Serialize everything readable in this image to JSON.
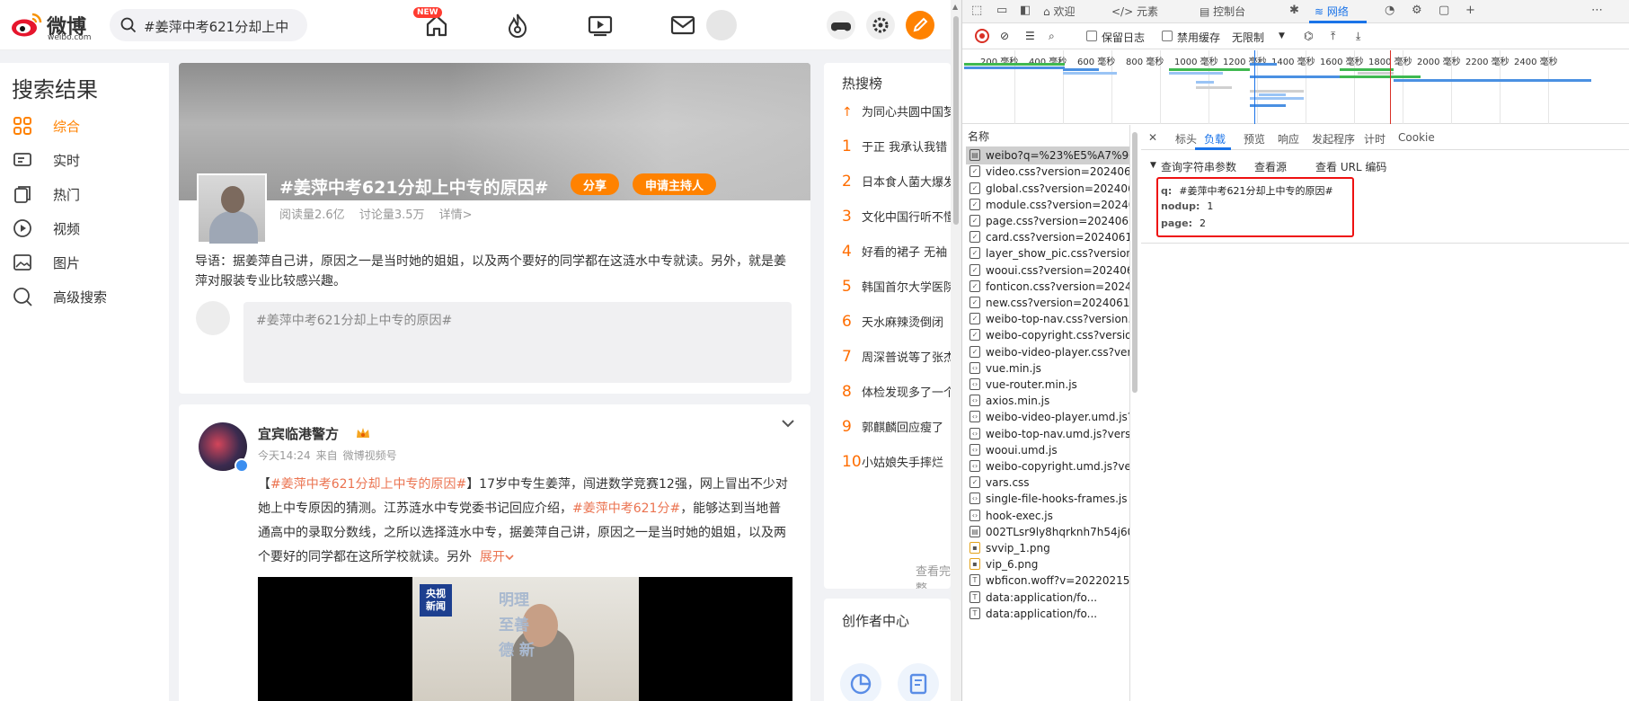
{
  "weibo": {
    "brand": "微博",
    "brand_sub": "weibo.com",
    "search": {
      "value": "#姜萍中考621分却上中"
    },
    "nav": {
      "new_badge": "NEW"
    },
    "leftnav": {
      "title": "搜索结果",
      "items": [
        {
          "label": "综合",
          "icon": "grid-icon",
          "active": true
        },
        {
          "label": "实时",
          "icon": "chat-icon"
        },
        {
          "label": "热门",
          "icon": "hot-icon"
        },
        {
          "label": "视频",
          "icon": "play-icon"
        },
        {
          "label": "图片",
          "icon": "image-icon"
        },
        {
          "label": "高级搜索",
          "icon": "search-icon"
        }
      ]
    },
    "topic_card": {
      "title": "#姜萍中考621分却上中专的原因#",
      "share_label": "分享",
      "host_label": "申请主持人",
      "reads": "阅读量2.6亿",
      "discussions": "讨论量3.5万",
      "details": "详情>",
      "guide": "导语：据姜萍自己讲，原因之一是当时她的姐姐，以及两个要好的同学都在这涟水中专就读。另外，就是姜萍对服装专业比较感兴趣。",
      "comment_placeholder": "#姜萍中考621分却上中专的原因#"
    },
    "post": {
      "author": "宜宾临港警方",
      "time": "今天14:24",
      "source_prefix": "来自",
      "source": "微博视频号",
      "text_open": "【",
      "link1": "#姜萍中考621分却上中专的原因#",
      "text_1": "】17岁中专生姜萍，闯进数学竞赛12强，网上冒出不少对她上中专原因的猜测。江苏涟水中专党委书记回应介绍，",
      "link2": "#姜萍中考621分#",
      "text_2": "，能够达到当地普通高中的录取分数线，之所以选择涟水中专，据姜萍自己讲，原因之一是当时她的姐姐，以及两个要好的同学都在这所学校就读。另外",
      "expand": "展开",
      "video_logo_1": "央视",
      "video_logo_2": "新闻",
      "video_signs": "明理 至善 德 新"
    },
    "hot": {
      "title": "热搜榜",
      "items": [
        {
          "rank": "",
          "text": "为同心共圆中国梦"
        },
        {
          "rank": "1",
          "text": "于正 我承认我错"
        },
        {
          "rank": "2",
          "text": "日本食人菌大爆发"
        },
        {
          "rank": "3",
          "text": "文化中国行听不懂"
        },
        {
          "rank": "4",
          "text": "好看的裙子 无袖"
        },
        {
          "rank": "5",
          "text": "韩国首尔大学医院"
        },
        {
          "rank": "6",
          "text": "天水麻辣烫倒闭"
        },
        {
          "rank": "7",
          "text": "周深普说等了张杰"
        },
        {
          "rank": "8",
          "text": "体检发现多了一个"
        },
        {
          "rank": "9",
          "text": "郭麒麟回应瘦了"
        },
        {
          "rank": "10",
          "text": "小姑娘失手摔烂"
        }
      ],
      "more": "查看完整"
    },
    "creator": {
      "title": "创作者中心"
    }
  },
  "devtools": {
    "tabs": [
      "欢迎",
      "元素",
      "控制台",
      "网络"
    ],
    "toolbar": {
      "preserve_log": "保留日志",
      "disable_cache": "禁用缓存",
      "throttle": "无限制"
    },
    "ticks": [
      "200 毫秒",
      "400 毫秒",
      "600 毫秒",
      "800 毫秒",
      "1000 毫秒",
      "1200 毫秒",
      "1400 毫秒",
      "1600 毫秒",
      "1800 毫秒",
      "2000 毫秒",
      "2200 毫秒",
      "2400 毫秒"
    ],
    "names_header": "名称",
    "requests": [
      {
        "name": "weibo?q=%23%E5%A7%9C...",
        "type": "doc",
        "selected": true
      },
      {
        "name": "video.css?version=2024061...",
        "type": "css"
      },
      {
        "name": "global.css?version=202406...",
        "type": "css"
      },
      {
        "name": "module.css?version=20240...",
        "type": "css"
      },
      {
        "name": "page.css?version=2024061...",
        "type": "css"
      },
      {
        "name": "card.css?version=20240611...",
        "type": "css"
      },
      {
        "name": "layer_show_pic.css?version...",
        "type": "css"
      },
      {
        "name": "wooui.css?version=202406...",
        "type": "css"
      },
      {
        "name": "fonticon.css?version=20240...",
        "type": "css"
      },
      {
        "name": "new.css?version=20240611...",
        "type": "css"
      },
      {
        "name": "weibo-top-nav.css?version...",
        "type": "css"
      },
      {
        "name": "weibo-copyright.css?versio...",
        "type": "css"
      },
      {
        "name": "weibo-video-player.css?ver...",
        "type": "css"
      },
      {
        "name": "vue.min.js",
        "type": "js"
      },
      {
        "name": "vue-router.min.js",
        "type": "js"
      },
      {
        "name": "axios.min.js",
        "type": "js"
      },
      {
        "name": "weibo-video-player.umd.js?...",
        "type": "js"
      },
      {
        "name": "weibo-top-nav.umd.js?versi...",
        "type": "js"
      },
      {
        "name": "wooui.umd.js",
        "type": "js"
      },
      {
        "name": "weibo-copyright.umd.js?ver...",
        "type": "js"
      },
      {
        "name": "vars.css",
        "type": "css"
      },
      {
        "name": "single-file-hooks-frames.js",
        "type": "js"
      },
      {
        "name": "hook-exec.js",
        "type": "js"
      },
      {
        "name": "002TLsr9ly8hqrknh7h54j60...",
        "type": "doc"
      },
      {
        "name": "svvip_1.png",
        "type": "img"
      },
      {
        "name": "vip_6.png",
        "type": "img"
      },
      {
        "name": "wbficon.woff?v=20220215",
        "type": "font"
      },
      {
        "name": "data:application/fo...",
        "type": "font"
      },
      {
        "name": "data:application/fo...",
        "type": "font"
      }
    ],
    "detail_tabs": [
      "标头",
      "负载",
      "预览",
      "响应",
      "发起程序",
      "计时",
      "Cookie"
    ],
    "payload": {
      "section": "查询字符串参数",
      "view_source": "查看源",
      "view_url_encoded": "查看 URL 编码",
      "params": [
        {
          "key": "q:",
          "value": "#姜萍中考621分却上中专的原因#"
        },
        {
          "key": "nodup:",
          "value": "1"
        },
        {
          "key": "page:",
          "value": "2"
        }
      ]
    }
  }
}
